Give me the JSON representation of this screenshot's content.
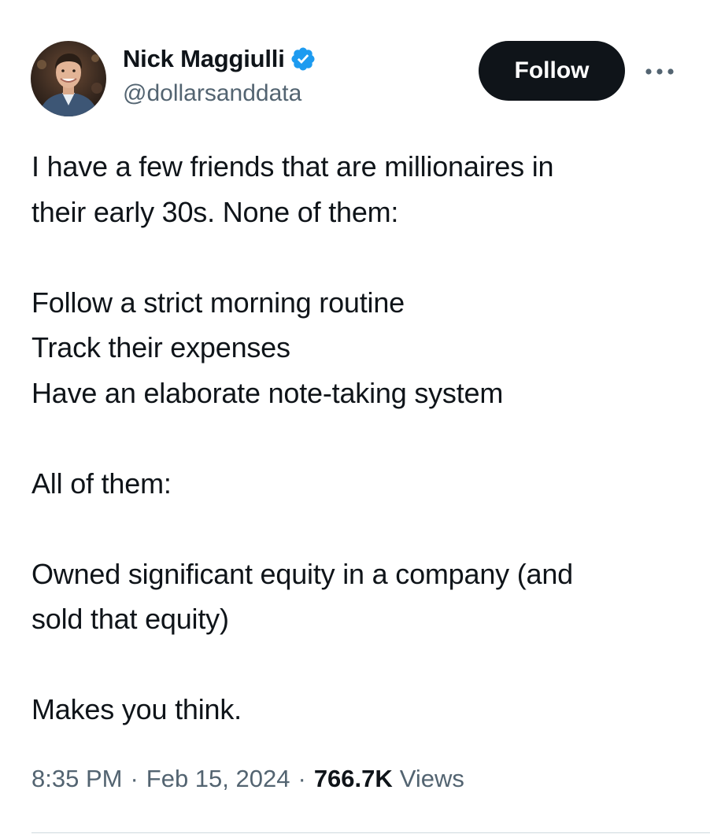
{
  "author": {
    "display_name": "Nick Maggiulli",
    "handle": "@dollarsanddata",
    "verified": true,
    "verified_color": "#1d9bf0"
  },
  "actions": {
    "follow_label": "Follow",
    "more_icon": "more-horizontal-icon"
  },
  "tweet": {
    "lines": [
      "I have a few friends that are millionaires in",
      "their early 30s. None of them:",
      "",
      "Follow a strict morning routine",
      "Track their expenses",
      "Have an elaborate note-taking system",
      "",
      "All of them:",
      "",
      "Owned significant equity in a company (and",
      "sold that equity)",
      "",
      "Makes you think."
    ]
  },
  "meta": {
    "time": "8:35 PM",
    "separator": "·",
    "date": "Feb 15, 2024",
    "views_count": "766.7K",
    "views_label": "Views"
  },
  "colors": {
    "text_primary": "#0f1419",
    "text_secondary": "#536471",
    "button_bg": "#0f1419",
    "divider": "#cfd9de"
  }
}
